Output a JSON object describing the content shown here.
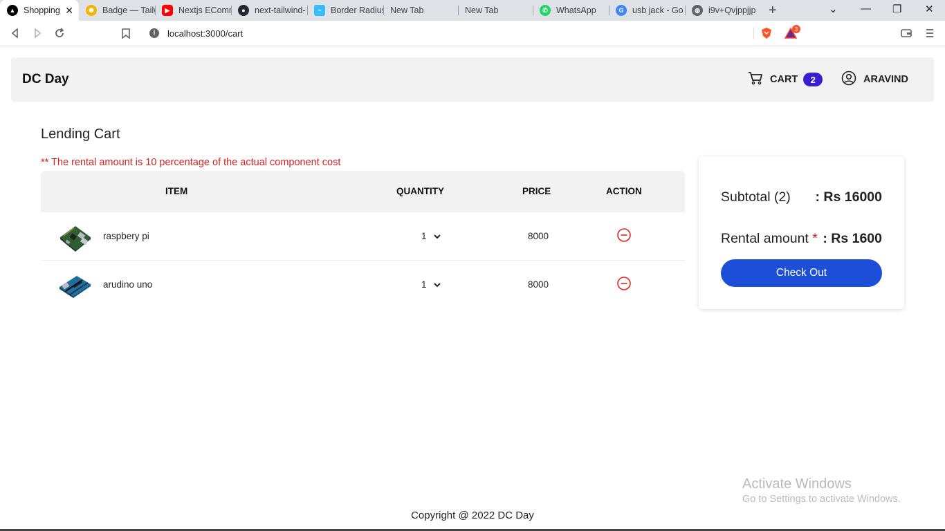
{
  "browser": {
    "tabs": [
      {
        "title": "Shopping",
        "icon": "nextjs-icon",
        "color": "#000000",
        "active": true
      },
      {
        "title": "Badge — Tailw",
        "icon": "sun-icon",
        "color": "#f4b400"
      },
      {
        "title": "Nextjs EComm",
        "icon": "youtube-icon",
        "color": "#ff0000"
      },
      {
        "title": "next-tailwind-",
        "icon": "github-icon",
        "color": "#24292f"
      },
      {
        "title": "Border Radius",
        "icon": "tailwind-icon",
        "color": "#38bdf8"
      },
      {
        "title": "New Tab",
        "icon": "none"
      },
      {
        "title": "New Tab",
        "icon": "none"
      },
      {
        "title": "WhatsApp",
        "icon": "whatsapp-icon",
        "color": "#25d366"
      },
      {
        "title": "usb jack - Go",
        "icon": "google-icon",
        "color": "#4285f4"
      },
      {
        "title": "i9v+Qvjppjjp",
        "icon": "globe-icon",
        "color": "#5f6368"
      }
    ],
    "url": "localhost:3000/cart",
    "brave_rewards_count": "3"
  },
  "navbar": {
    "brand": "DC Day",
    "cart_label": "CART",
    "cart_count": "2",
    "user_label": "ARAVIND",
    "accent": "#3b1ed4"
  },
  "cart": {
    "title": "Lending Cart",
    "note": "** The rental amount is 10 percentage of the actual component cost",
    "headers": {
      "item": "ITEM",
      "quantity": "QUANTITY",
      "price": "PRICE",
      "action": "ACTION"
    },
    "items": [
      {
        "name": "raspbery pi",
        "quantity": "1",
        "price": "8000",
        "image": "raspberry-pi-image"
      },
      {
        "name": "arudino uno",
        "quantity": "1",
        "price": "8000",
        "image": "arduino-uno-image"
      }
    ]
  },
  "summary": {
    "subtotal_label": "Subtotal (2)",
    "subtotal_value": ": Rs 16000",
    "rental_label": "Rental amount",
    "rental_asterisk": "*",
    "rental_value": ": Rs 1600",
    "checkout_label": "Check Out",
    "button_color": "#1d4ed8"
  },
  "watermark": {
    "line1": "Activate Windows",
    "line2": "Go to Settings to activate Windows."
  },
  "footer": {
    "copyright": "Copyright @ 2022 DC Day"
  }
}
